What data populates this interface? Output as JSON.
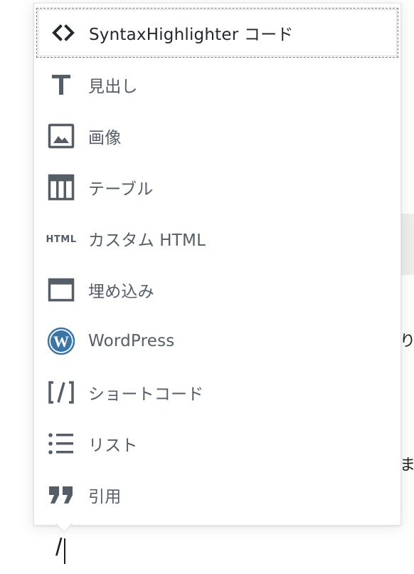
{
  "background": {
    "text_fragments": [
      "り",
      "ま"
    ]
  },
  "block_menu": {
    "items": [
      {
        "label": "SyntaxHighlighter コード",
        "icon": "code-icon",
        "selected": true
      },
      {
        "label": "見出し",
        "icon": "heading-icon",
        "selected": false
      },
      {
        "label": "画像",
        "icon": "image-icon",
        "selected": false
      },
      {
        "label": "テーブル",
        "icon": "table-icon",
        "selected": false
      },
      {
        "label": "カスタム HTML",
        "icon": "html-icon",
        "selected": false
      },
      {
        "label": "埋め込み",
        "icon": "embed-icon",
        "selected": false
      },
      {
        "label": "WordPress",
        "icon": "wordpress-icon",
        "selected": false
      },
      {
        "label": "ショートコード",
        "icon": "shortcode-icon",
        "selected": false
      },
      {
        "label": "リスト",
        "icon": "list-icon",
        "selected": false
      },
      {
        "label": "引用",
        "icon": "quote-icon",
        "selected": false
      }
    ]
  },
  "editor": {
    "typed_text": "/"
  },
  "colors": {
    "icon": "#555d66",
    "label": "#555d66",
    "wordpress_blue": "#3a75a8"
  }
}
